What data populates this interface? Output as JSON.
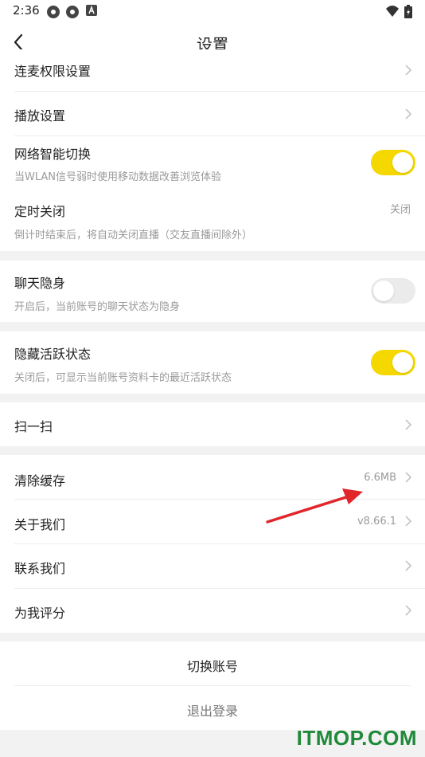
{
  "status_bar": {
    "time": "2:36"
  },
  "header": {
    "title": "设置"
  },
  "settings": {
    "mic_permission": {
      "label": "连麦权限设置"
    },
    "playback": {
      "label": "播放设置"
    },
    "smart_switch": {
      "label": "网络智能切换",
      "sub": "当WLAN信号弱时使用移动数据改善浏览体验",
      "enabled": true
    },
    "timer_off": {
      "label": "定时关闭",
      "sub": "倒计时结束后，将自动关闭直播（交友直播间除外）",
      "value": "关闭"
    },
    "chat_invisible": {
      "label": "聊天隐身",
      "sub": "开启后，当前账号的聊天状态为隐身",
      "enabled": false
    },
    "hide_active": {
      "label": "隐藏活跃状态",
      "sub": "关闭后，可显示当前账号资料卡的最近活跃状态",
      "enabled": true
    },
    "scan": {
      "label": "扫一扫"
    },
    "clear_cache": {
      "label": "清除缓存",
      "value": "6.6MB"
    },
    "about": {
      "label": "关于我们",
      "value": "v8.66.1"
    },
    "contact": {
      "label": "联系我们"
    },
    "rate": {
      "label": "为我评分"
    }
  },
  "account": {
    "switch_label": "切换账号",
    "logout_label": "退出登录"
  },
  "watermark": "ITMOP.COM",
  "colors": {
    "toggle_on": "#f5d800",
    "toggle_off": "#ebebeb",
    "annotation_arrow": "#e0262b",
    "watermark": "#1f8a3a"
  }
}
